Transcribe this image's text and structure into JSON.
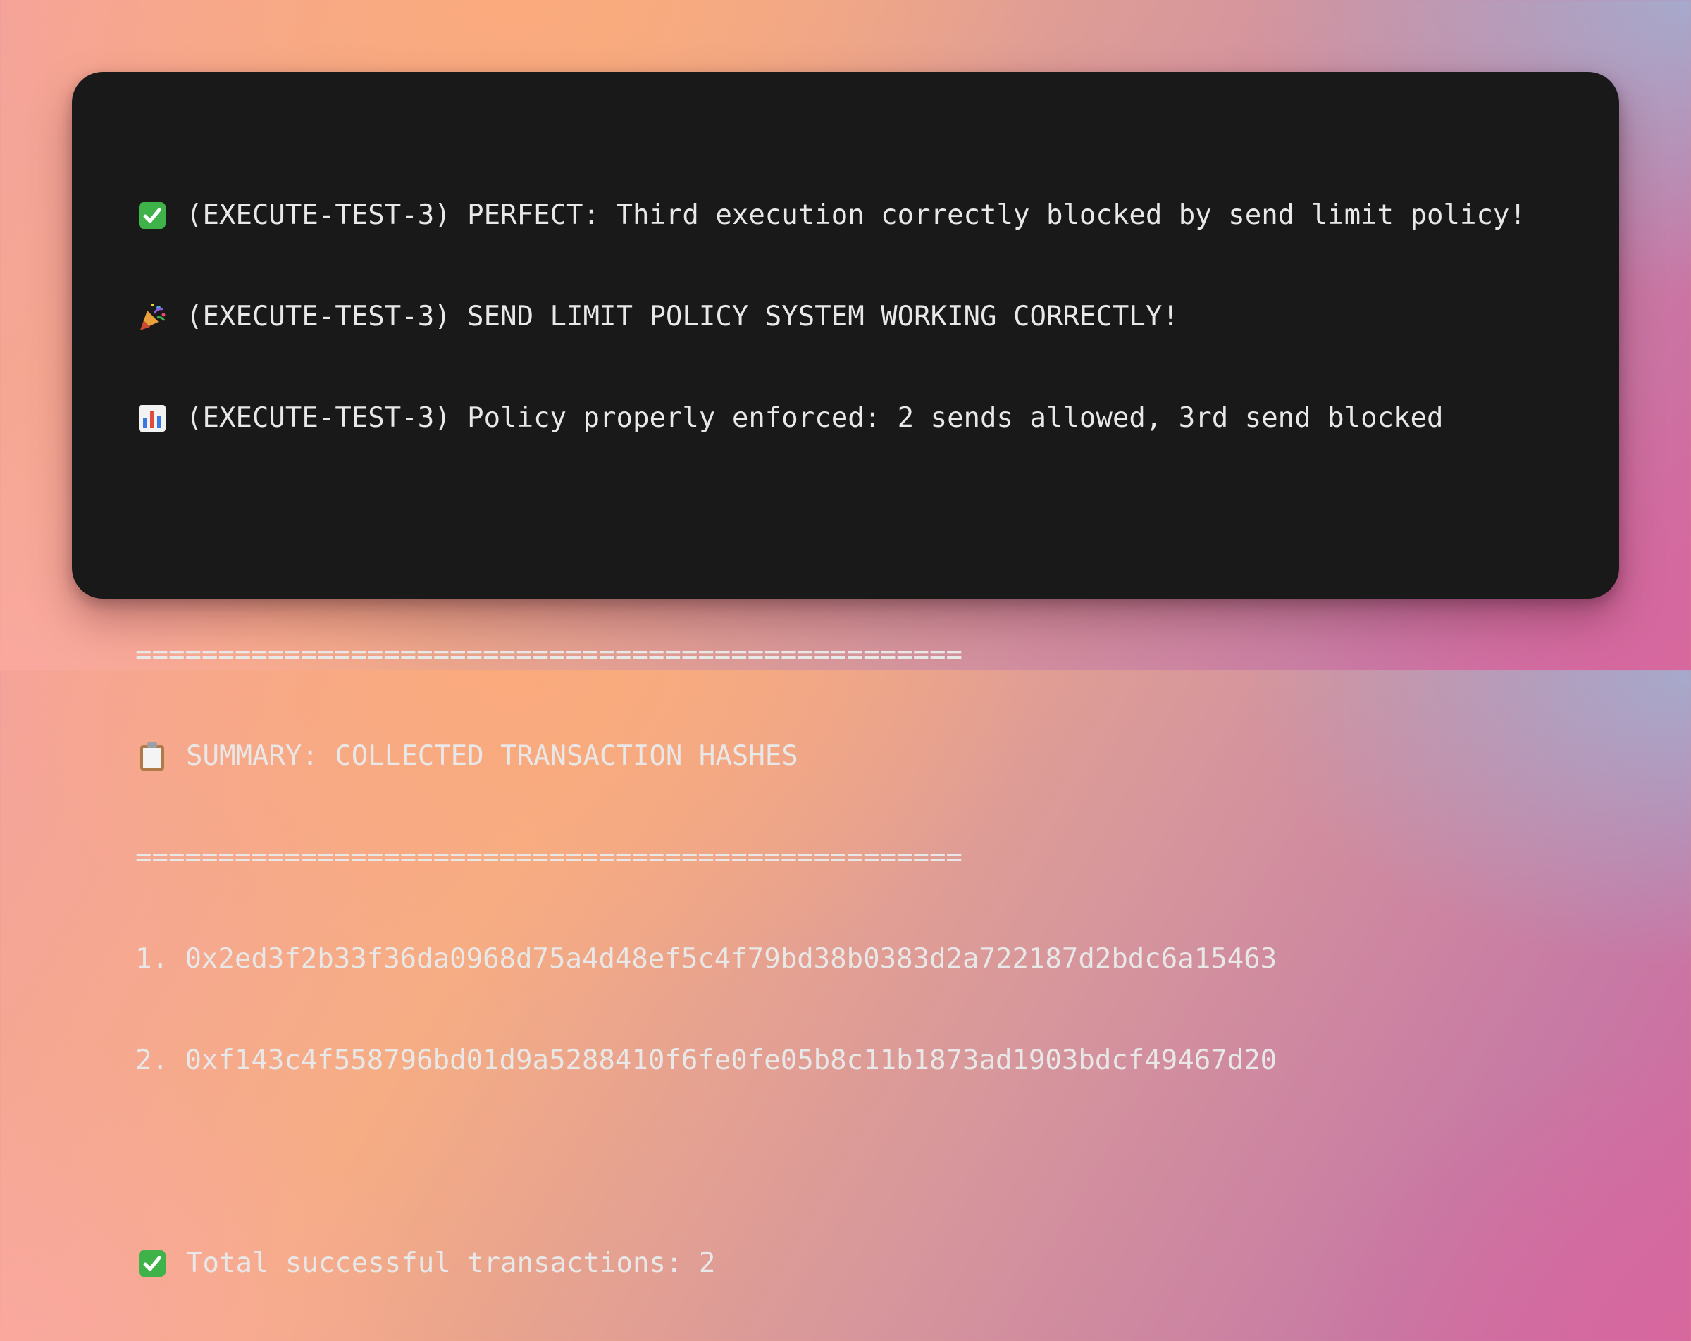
{
  "terminal": {
    "lines": [
      {
        "icon": "check-icon",
        "text": "(EXECUTE-TEST-3) PERFECT: Third execution correctly blocked by send limit policy!"
      },
      {
        "icon": "party-popper-icon",
        "text": "(EXECUTE-TEST-3) SEND LIMIT POLICY SYSTEM WORKING CORRECTLY!"
      },
      {
        "icon": "bar-chart-icon",
        "text": "(EXECUTE-TEST-3) Policy properly enforced: 2 sends allowed, 3rd send blocked"
      }
    ],
    "separator": "==================================================",
    "summary_icon": "clipboard-icon",
    "summary_title": "SUMMARY: COLLECTED TRANSACTION HASHES",
    "hashes": [
      "1. 0x2ed3f2b33f36da0968d75a4d48ef5c4f79bd38b0383d2a722187d2bdc6a15463",
      "2. 0xf143c4f558796bd01d9a5288410f6fe0fe05b8c11b1873ad1903bdcf49467d20"
    ],
    "total_icon": "check-icon",
    "total_text": "Total successful transactions: 2"
  },
  "colors": {
    "terminal_background": "#191919",
    "text": "#e8e8e8",
    "check_green": "#3fb24a"
  }
}
